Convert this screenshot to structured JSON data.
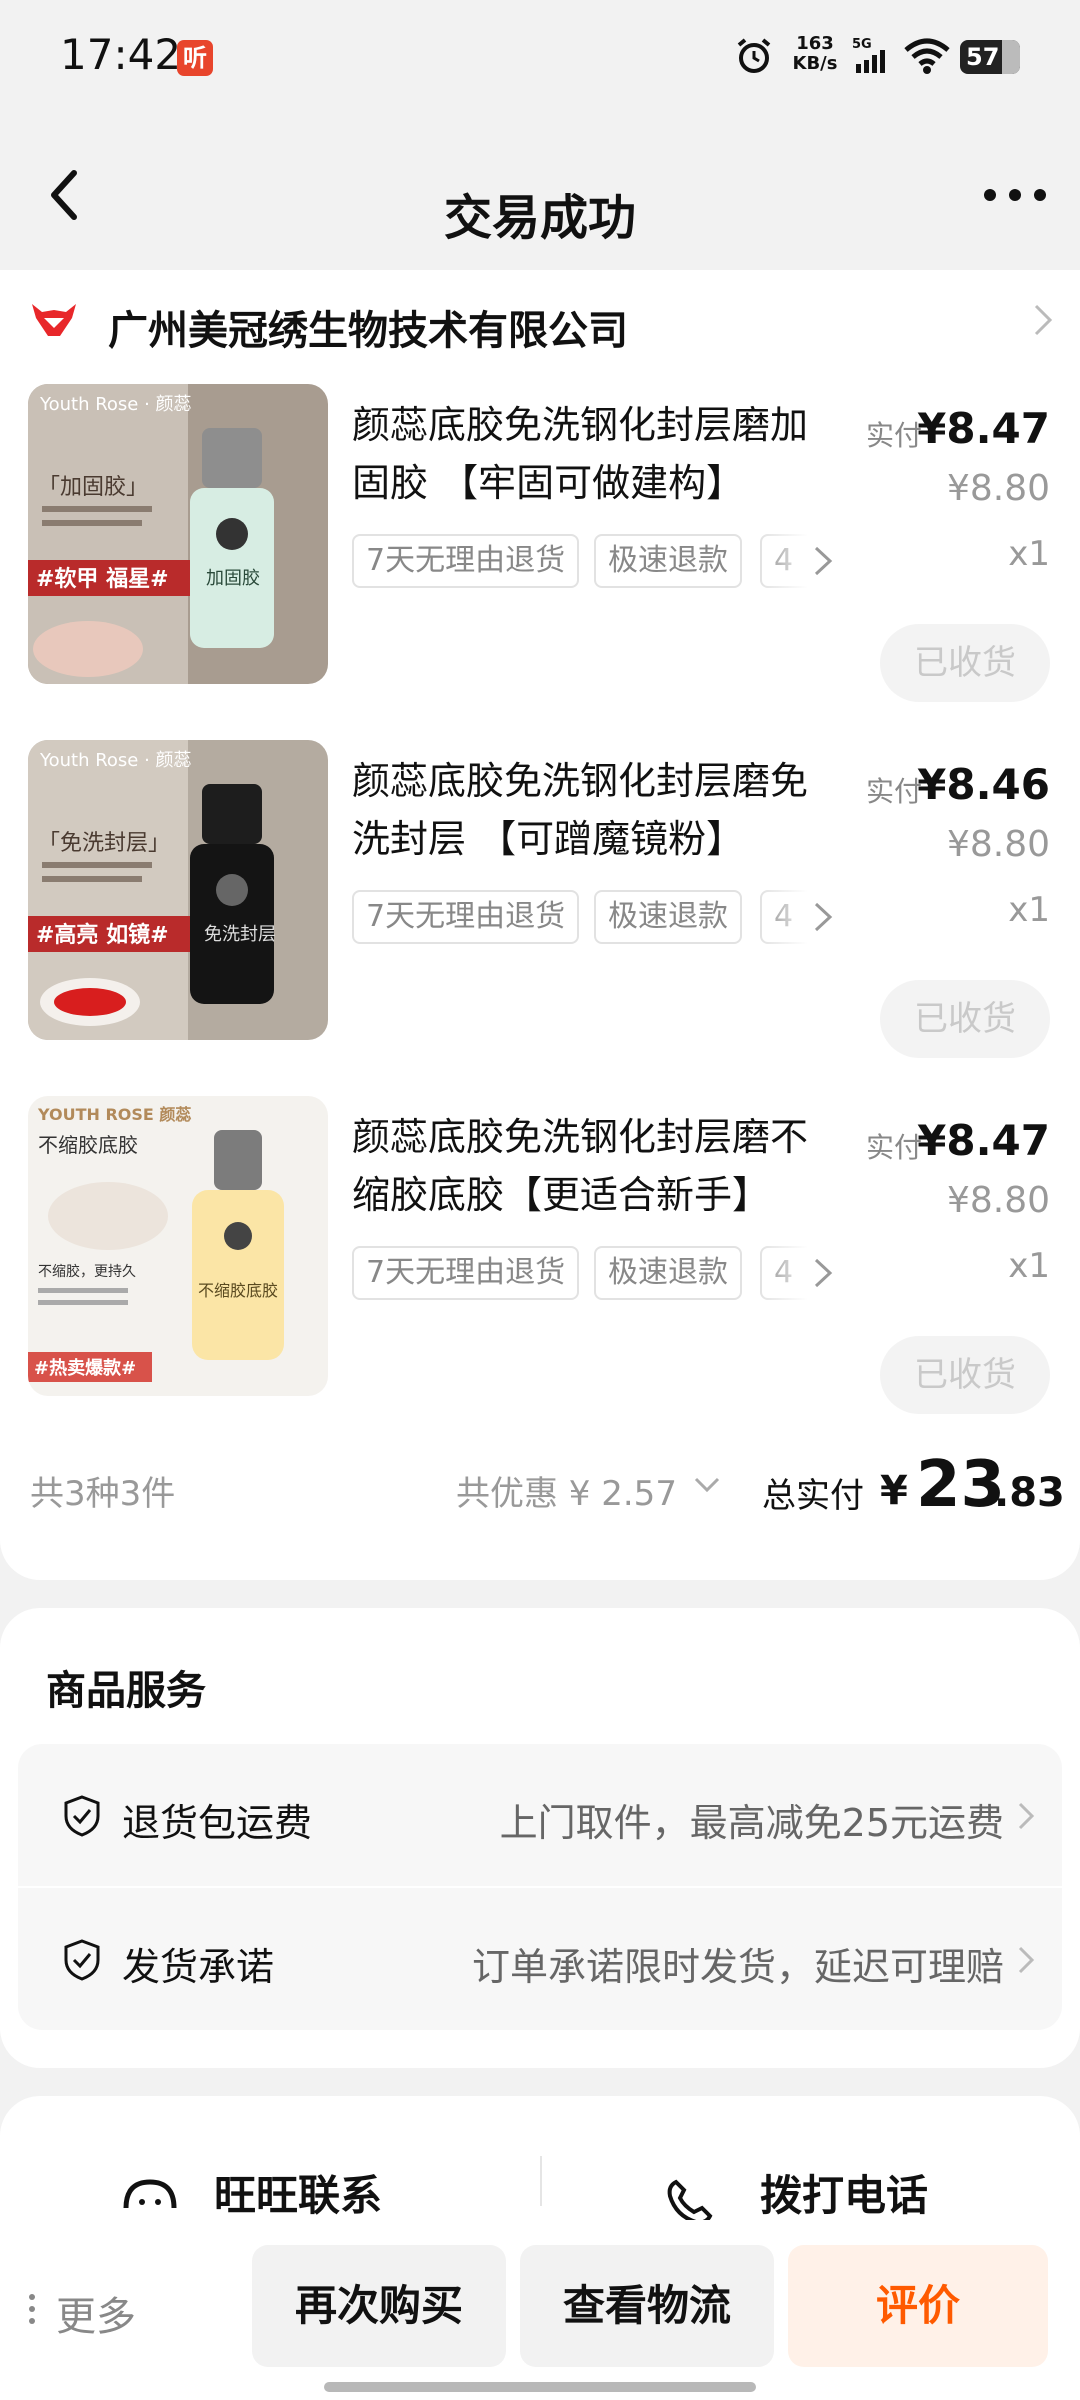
{
  "status_bar": {
    "time": "17:42",
    "app_badge": "听",
    "net_speed_value": "163",
    "net_speed_unit": "KB/s",
    "signal": "5G",
    "battery": "57"
  },
  "nav": {
    "title": "交易成功"
  },
  "shop": {
    "name": "广州美冠绣生物技术有限公司"
  },
  "items": [
    {
      "title": "颜蕊底胶免洗钢化封层磨加固胶 【牢固可做建构】",
      "tags": [
        "7天无理由退货",
        "极速退款",
        "4"
      ],
      "price_label": "实付",
      "price": "¥8.47",
      "original_price": "¥8.80",
      "qty": "x1",
      "status_button": "已收货",
      "image_texts": [
        "Youth Rose · 颜蕊",
        "「加固胶」",
        "#软甲 福星#",
        "加固胶"
      ]
    },
    {
      "title": "颜蕊底胶免洗钢化封层磨免洗封层 【可蹭魔镜粉】",
      "tags": [
        "7天无理由退货",
        "极速退款",
        "4"
      ],
      "price_label": "实付",
      "price": "¥8.46",
      "original_price": "¥8.80",
      "qty": "x1",
      "status_button": "已收货",
      "image_texts": [
        "Youth Rose · 颜蕊",
        "「免洗封层」",
        "#高亮 如镜#",
        "免洗封层"
      ]
    },
    {
      "title": "颜蕊底胶免洗钢化封层磨不缩胶底胶【更适合新手】",
      "tags": [
        "7天无理由退货",
        "极速退款",
        "4"
      ],
      "price_label": "实付",
      "price": "¥8.47",
      "original_price": "¥8.80",
      "qty": "x1",
      "status_button": "已收货",
      "image_texts": [
        "YOUTH ROSE 颜蕊",
        "不缩胶底胶",
        "不缩胶，更持久",
        "#热卖爆款#",
        "不缩胶底胶"
      ]
    }
  ],
  "summary": {
    "count": "共3种3件",
    "discount": "共优惠 ¥ 2.57",
    "total_label": "总实付",
    "total_yen": "¥",
    "total_int": "23",
    "total_dec": ".83"
  },
  "services": {
    "title": "商品服务",
    "rows": [
      {
        "label": "退货包运费",
        "desc": "上门取件，最高减免25元运费"
      },
      {
        "label": "发货承诺",
        "desc": "订单承诺限时发货，延迟可理赔"
      }
    ]
  },
  "contact": {
    "wangwang": "旺旺联系",
    "phone": "拨打电话"
  },
  "actions": {
    "more": "更多",
    "buy_again": "再次购买",
    "logistics": "查看物流",
    "review": "评价"
  },
  "colors": {
    "accent": "#ff5a00",
    "brand_red": "#e8452c",
    "page_bg": "#f2f2f2"
  }
}
